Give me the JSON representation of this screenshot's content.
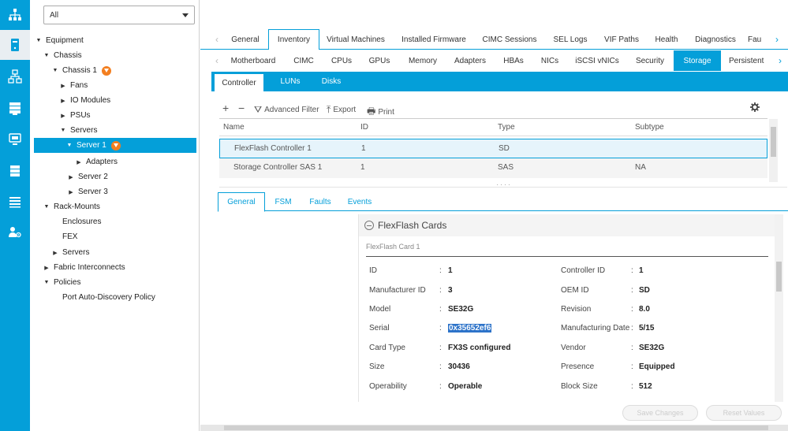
{
  "rail": {
    "items": [
      {
        "icon": "network-topology-icon"
      },
      {
        "icon": "server-icon"
      },
      {
        "icon": "lan-icon"
      },
      {
        "icon": "storage-icon"
      },
      {
        "icon": "vm-monitor-icon"
      },
      {
        "icon": "chassis-stack-icon"
      },
      {
        "icon": "admin-list-icon"
      },
      {
        "icon": "user-settings-icon"
      }
    ],
    "accent": "#049fd9"
  },
  "filter": {
    "selected": "All"
  },
  "tree": {
    "nodes": [
      {
        "label": "Equipment",
        "toggle": "▼"
      },
      {
        "label": "Chassis",
        "toggle": "▼"
      },
      {
        "label": "Chassis 1",
        "toggle": "▼",
        "badge": "warning-badge-icon"
      },
      {
        "label": "Fans",
        "toggle": "▶"
      },
      {
        "label": "IO Modules",
        "toggle": "▶"
      },
      {
        "label": "PSUs",
        "toggle": "▶"
      },
      {
        "label": "Servers",
        "toggle": "▼"
      },
      {
        "label": "Server 1",
        "toggle": "▼",
        "badge": "warning-badge-icon",
        "selected": true
      },
      {
        "label": "Adapters",
        "toggle": "▶"
      },
      {
        "label": "Server 2",
        "toggle": "▶"
      },
      {
        "label": "Server 3",
        "toggle": "▶"
      },
      {
        "label": "Rack-Mounts",
        "toggle": "▼"
      },
      {
        "label": "Enclosures",
        "toggle": ""
      },
      {
        "label": "FEX",
        "toggle": ""
      },
      {
        "label": "Servers",
        "toggle": "▶"
      },
      {
        "label": "Fabric Interconnects",
        "toggle": "▶"
      },
      {
        "label": "Policies",
        "toggle": "▼"
      },
      {
        "label": "Port Auto-Discovery Policy",
        "toggle": ""
      }
    ]
  },
  "tabs_primary": {
    "items": [
      "General",
      "Inventory",
      "Virtual Machines",
      "Installed Firmware",
      "CIMC Sessions",
      "SEL Logs",
      "VIF Paths",
      "Health",
      "Diagnostics",
      "Fau"
    ],
    "active": "Inventory"
  },
  "tabs_secondary": {
    "items": [
      "Motherboard",
      "CIMC",
      "CPUs",
      "GPUs",
      "Memory",
      "Adapters",
      "HBAs",
      "NICs",
      "iSCSI vNICs",
      "Security",
      "Storage",
      "Persistent"
    ],
    "active": "Storage"
  },
  "tabs_tertiary": {
    "items": [
      "Controller",
      "LUNs",
      "Disks"
    ],
    "active": "Controller"
  },
  "toolbar": {
    "add": "+",
    "remove": "−",
    "filter": "Advanced Filter",
    "export": "Export",
    "print": "Print"
  },
  "grid": {
    "columns": [
      "Name",
      "ID",
      "Type",
      "Subtype"
    ],
    "rows": [
      {
        "name": "FlexFlash Controller 1",
        "id": "1",
        "type": "SD",
        "subtype": "",
        "selected": true
      },
      {
        "name": "Storage Controller SAS 1",
        "id": "1",
        "type": "SAS",
        "subtype": "NA",
        "selected": false
      }
    ],
    "splitter": "· · · ·"
  },
  "detail_tabs": {
    "items": [
      "General",
      "FSM",
      "Faults",
      "Events"
    ],
    "active": "General"
  },
  "flexflash": {
    "title": "FlexFlash Cards",
    "card_title": "FlexFlash Card 1",
    "left": [
      {
        "label": "ID",
        "value": "1"
      },
      {
        "label": "Manufacturer ID",
        "value": "3"
      },
      {
        "label": "Model",
        "value": "SE32G"
      },
      {
        "label": "Serial",
        "value": "0x35652ef6",
        "highlight": true
      },
      {
        "label": "Card Type",
        "value": "FX3S configured"
      },
      {
        "label": "Size",
        "value": "30436"
      },
      {
        "label": "Operability",
        "value": "Operable"
      }
    ],
    "right": [
      {
        "label": "Controller ID",
        "value": "1"
      },
      {
        "label": "OEM ID",
        "value": "SD"
      },
      {
        "label": "Revision",
        "value": "8.0"
      },
      {
        "label": "Manufacturing Date",
        "value": "5/15"
      },
      {
        "label": "Vendor",
        "value": "SE32G"
      },
      {
        "label": "Presence",
        "value": "Equipped"
      },
      {
        "label": "Block Size",
        "value": "512"
      }
    ]
  },
  "buttons": {
    "save": "Save Changes",
    "reset": "Reset Values"
  }
}
